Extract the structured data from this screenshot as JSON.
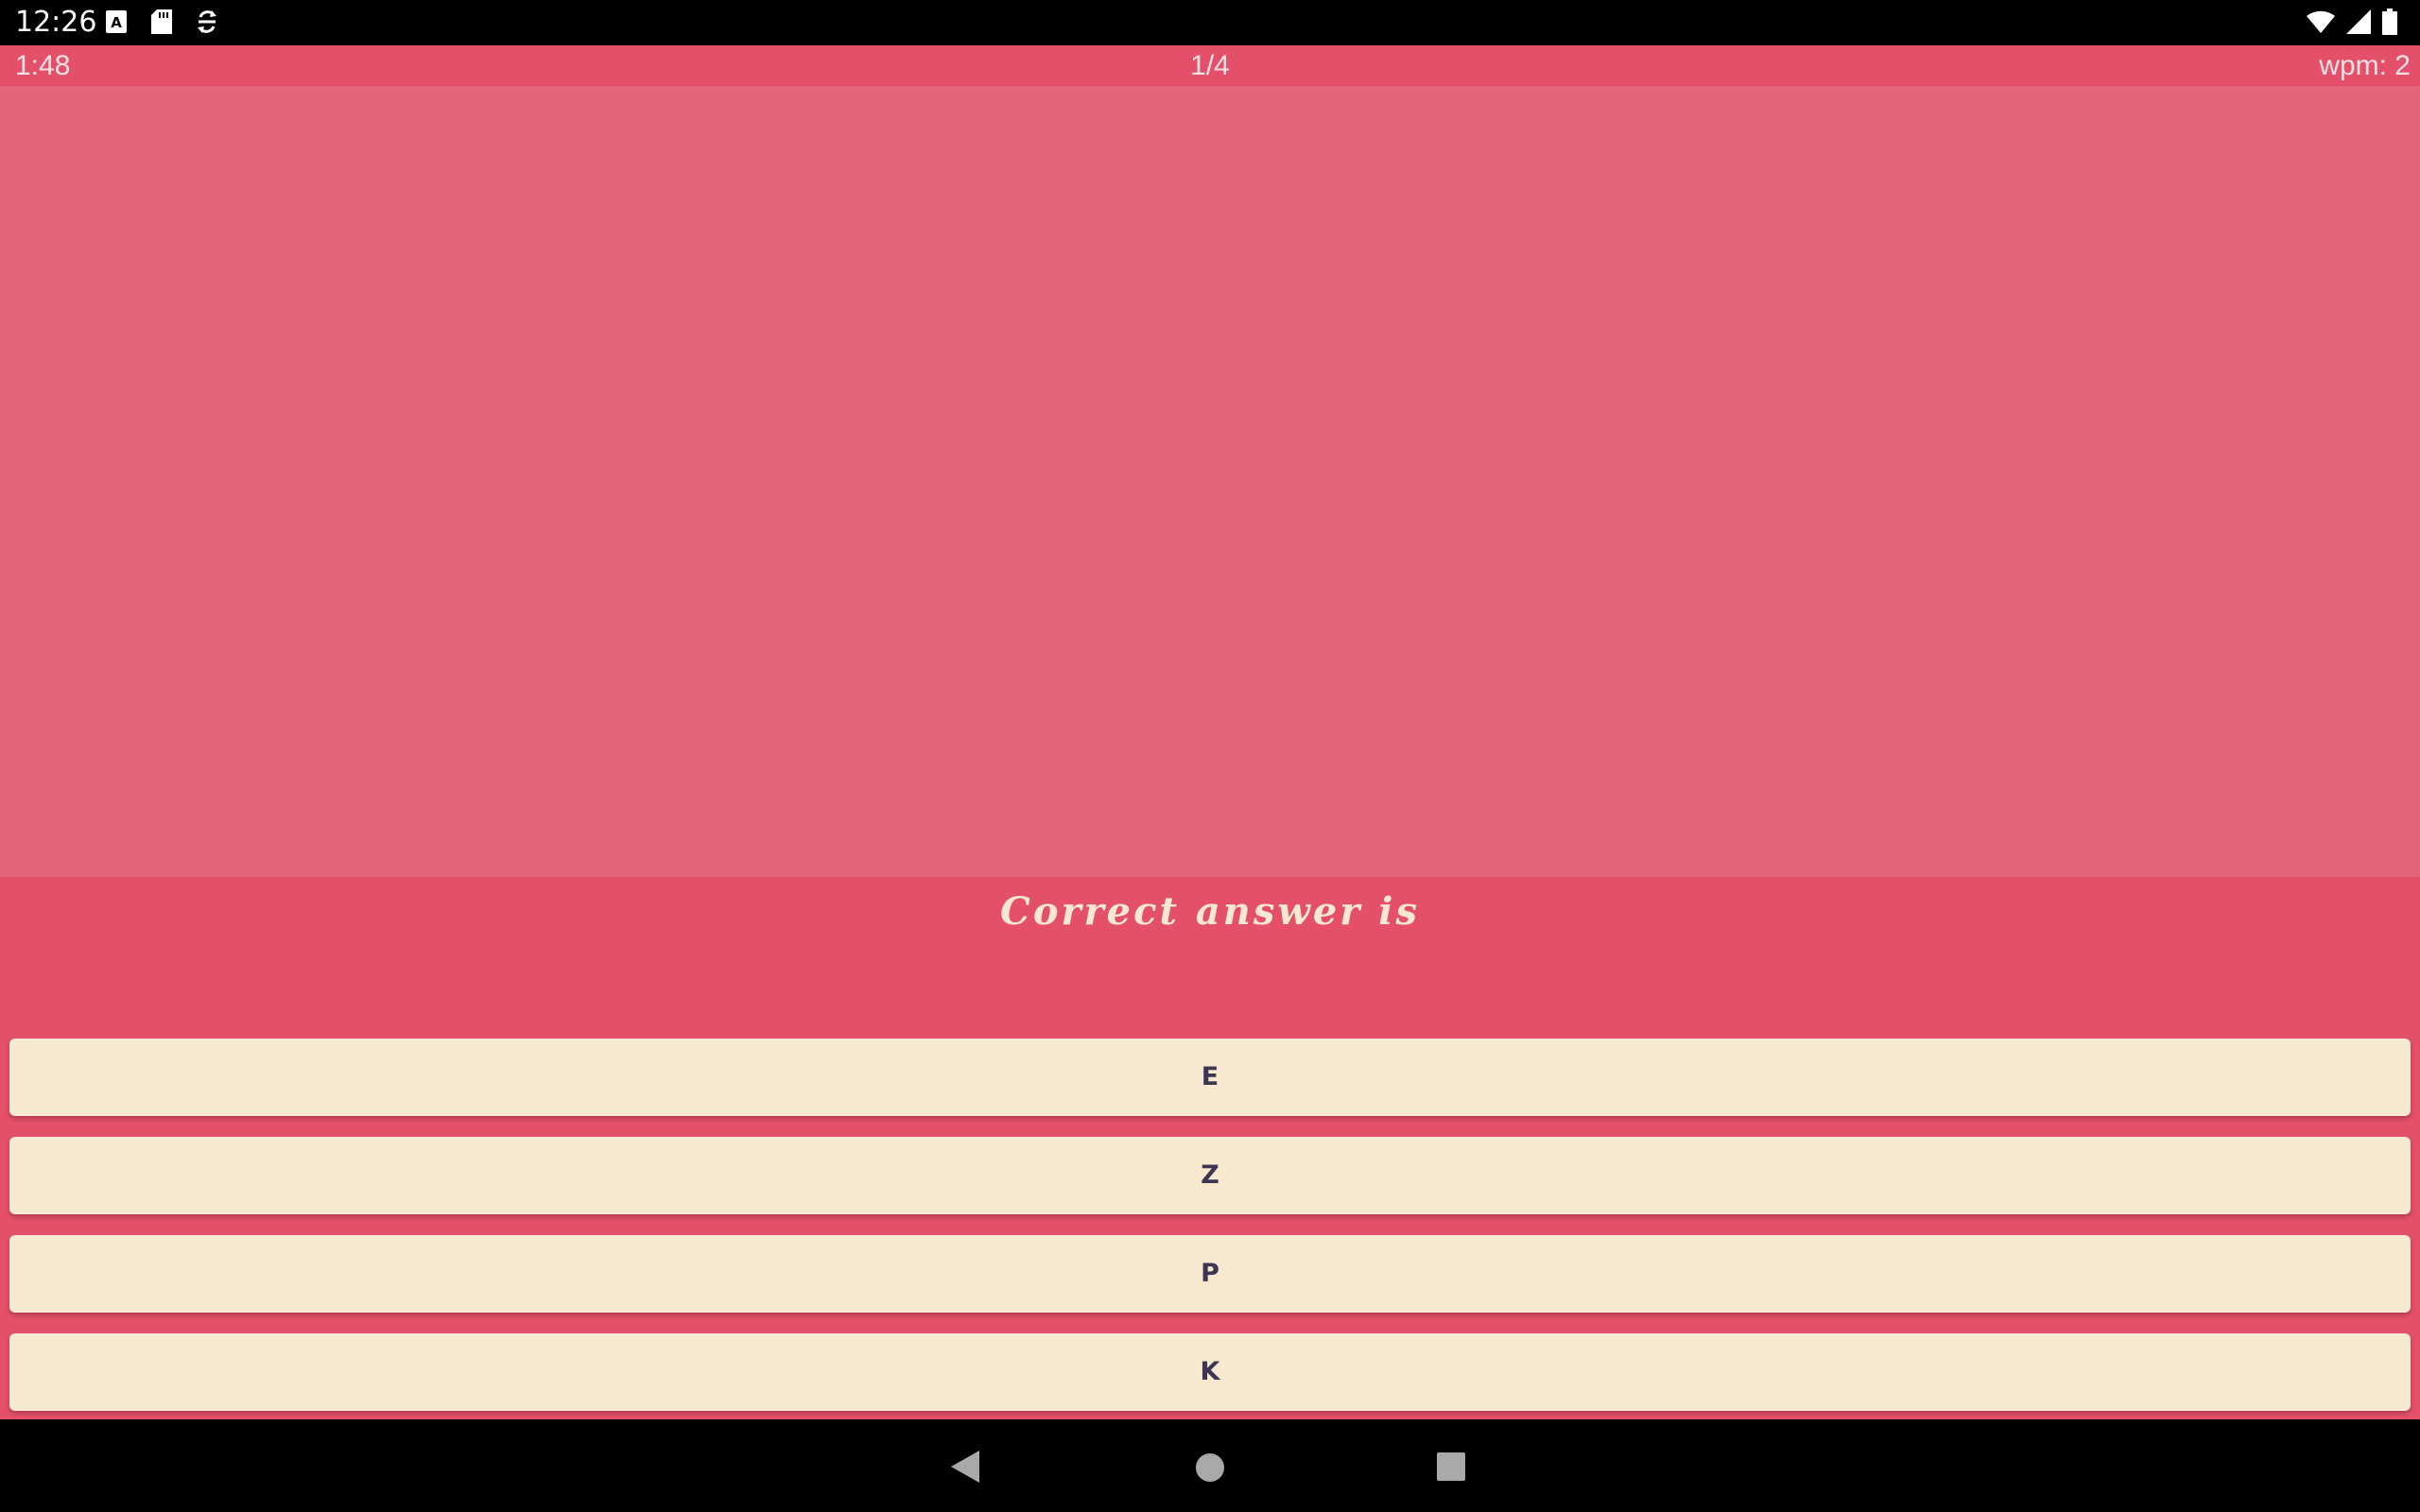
{
  "status_bar": {
    "time": "12:26",
    "left_icons": [
      "font-icon",
      "sd-card-icon",
      "sync-icon"
    ],
    "right_icons": [
      "wifi-icon",
      "cellular-signal-icon",
      "battery-icon"
    ]
  },
  "info_bar": {
    "timer": "1:48",
    "progress": "1/4",
    "wpm": "wpm: 2"
  },
  "answer": {
    "heading": "Correct answer is",
    "options": [
      "E",
      "Z",
      "P",
      "K"
    ]
  },
  "nav_bar": {
    "buttons": [
      "back-icon",
      "home-icon",
      "recent-apps-icon"
    ]
  },
  "colors": {
    "header": "#e4506a",
    "prompt_area": "#e3647a",
    "option_bg": "#f6e9cf",
    "option_text": "#3e3552",
    "heading_text": "#f8e8cf"
  }
}
